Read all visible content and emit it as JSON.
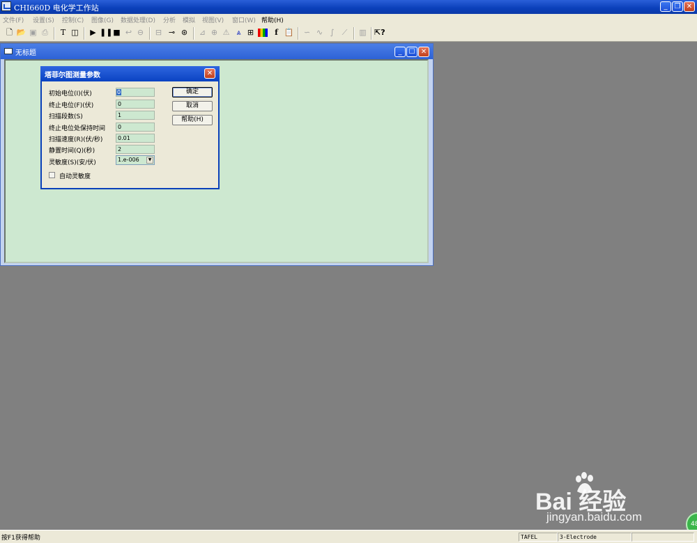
{
  "app": {
    "title": "CHI660D 电化学工作站",
    "window_buttons": {
      "minimize": "_",
      "restore": "❐",
      "close": "✕"
    }
  },
  "menu": [
    "文件(F)",
    "设置(S)",
    "控制(C)",
    "图像(G)",
    "数据处理(D)",
    "分析",
    "模拟",
    "视图(V)",
    "窗口(W)",
    "帮助(H)"
  ],
  "toolbar": {
    "icons": [
      "new-file-icon",
      "open-folder-icon",
      "save-icon",
      "print-icon",
      "technique-icon",
      "parameters-icon",
      "run-icon",
      "pause-icon",
      "stop-icon",
      "reverse-icon",
      "filter-icon",
      "cell-icon",
      "graph-options-icon",
      "zoom-icon",
      "manual-result-icon",
      "peak-icon",
      "overlay-icon",
      "color-icon",
      "font-icon",
      "copy-icon",
      "smooth-icon",
      "derivative-icon",
      "integral-icon",
      "semilog-icon",
      "help-icon"
    ]
  },
  "child_window": {
    "title": "无标题"
  },
  "dialog": {
    "title": "塔菲尔图测量参数",
    "fields": [
      {
        "label": "初始电位(I)(伏)",
        "value": "0"
      },
      {
        "label": "终止电位(F)(伏)",
        "value": "0"
      },
      {
        "label": "扫描段数(S)",
        "value": "1"
      },
      {
        "label": "终止电位处保持时间",
        "value": "0"
      },
      {
        "label": "扫描速度(R)(伏/秒)",
        "value": "0.01"
      },
      {
        "label": "静置时间(Q)(秒)",
        "value": "2"
      }
    ],
    "sensitivity": {
      "label": "灵敏度(S)(安/伏)",
      "value": "1.e-006"
    },
    "auto_sens_label": "自动灵敏度",
    "buttons": {
      "ok": "确定",
      "cancel": "取消",
      "help": "帮助(H)"
    }
  },
  "status": {
    "help_text": "按F1获得帮助",
    "technique": "TAFEL",
    "electrode": "3-Electrode"
  },
  "watermark": {
    "brand": "Bai  经验",
    "url": "jingyan.baidu.com",
    "badge": "48"
  }
}
